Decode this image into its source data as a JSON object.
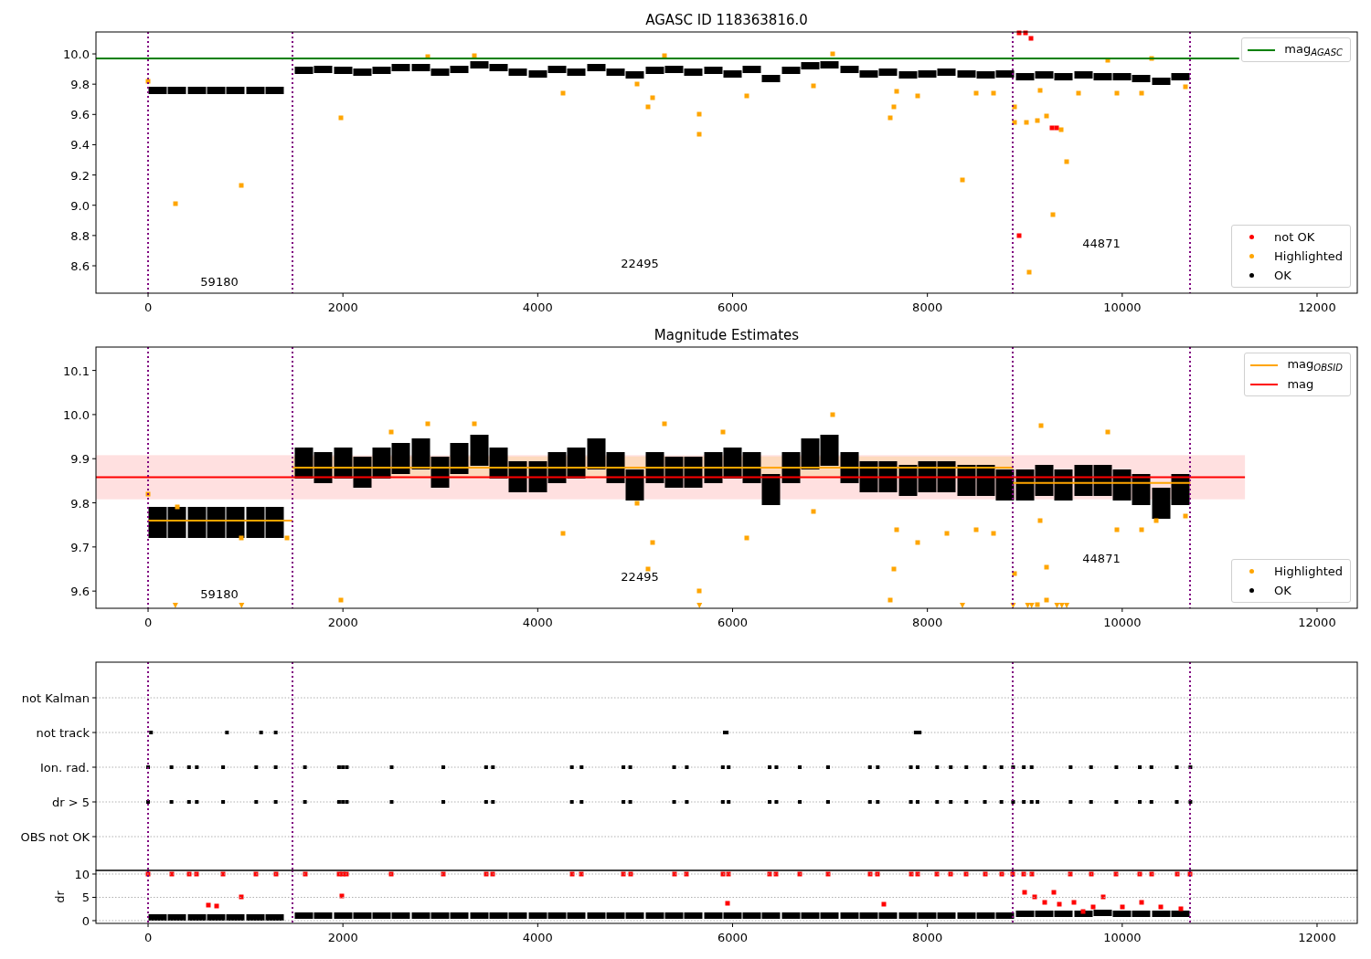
{
  "figure": {
    "panels": [
      {
        "chart_data": {
          "type": "scatter",
          "title": "AGASC ID 118363816.0",
          "xlim": [
            -535,
            12413
          ],
          "ylim": [
            8.419,
            10.145
          ],
          "xticks": [
            0,
            2000,
            4000,
            6000,
            8000,
            10000,
            12000
          ],
          "yticks": [
            {
              "value": 8.6,
              "label": "8.6"
            },
            {
              "value": 8.8,
              "label": "8.8"
            },
            {
              "value": 9.0,
              "label": "9.0"
            },
            {
              "value": 9.2,
              "label": "9.2"
            },
            {
              "value": 9.4,
              "label": "9.4"
            },
            {
              "value": 9.6,
              "label": "9.6"
            },
            {
              "value": 9.8,
              "label": "9.8"
            },
            {
              "value": 10.0,
              "label": "10.0"
            }
          ],
          "series": [
            {
              "name": "mag$_{AGASC}$",
              "color": "#008000",
              "type": "line",
              "x": [
                -535,
                11200
              ],
              "values": [
                9.97,
                9.97
              ]
            },
            {
              "name": "OK",
              "color": "#000000",
              "type": "scatter",
              "x": [
                100,
                300,
                500,
                700,
                900,
                1100,
                1300,
                1600,
                1800,
                2000,
                2200,
                2400,
                2600,
                2800,
                3000,
                3200,
                3400,
                3600,
                3800,
                4000,
                4200,
                4400,
                4600,
                4800,
                5000,
                5200,
                5400,
                5600,
                5800,
                6000,
                6200,
                6400,
                6600,
                6800,
                7000,
                7200,
                7400,
                7600,
                7800,
                8000,
                8200,
                8400,
                8600,
                8800,
                9000,
                9200,
                9400,
                9600,
                9800,
                10000,
                10200,
                10400,
                10600
              ],
              "values": [
                9.76,
                9.76,
                9.76,
                9.76,
                9.76,
                9.76,
                9.76,
                9.89,
                9.9,
                9.89,
                9.88,
                9.89,
                9.91,
                9.91,
                9.88,
                9.9,
                9.93,
                9.91,
                9.88,
                9.87,
                9.9,
                9.88,
                9.91,
                9.88,
                9.86,
                9.89,
                9.9,
                9.88,
                9.89,
                9.87,
                9.9,
                9.84,
                9.89,
                9.92,
                9.93,
                9.9,
                9.87,
                9.88,
                9.86,
                9.87,
                9.88,
                9.87,
                9.86,
                9.87,
                9.85,
                9.86,
                9.85,
                9.86,
                9.85,
                9.85,
                9.84,
                9.82,
                9.85
              ]
            },
            {
              "name": "Highlighted",
              "color": "#ffa500",
              "type": "scatter",
              "x": [
                0,
                280,
                960,
                1980,
                2870,
                3350,
                4260,
                5020,
                5130,
                5180,
                5300,
                5660,
                5660,
                6150,
                6830,
                7030,
                7620,
                7660,
                7680,
                7900,
                8360,
                8500,
                8680,
                8890,
                8890,
                9020,
                9040,
                9130,
                9160,
                9220,
                9290,
                9370,
                9430,
                9550,
                9850,
                9950,
                10200,
                10300,
                10650
              ],
              "values": [
                9.82,
                9.01,
                9.13,
                9.58,
                9.98,
                9.99,
                9.74,
                9.8,
                9.65,
                9.71,
                9.99,
                9.6,
                9.47,
                9.72,
                9.79,
                10.0,
                9.58,
                9.65,
                9.75,
                9.72,
                9.17,
                9.74,
                9.74,
                9.65,
                9.55,
                9.55,
                8.56,
                9.56,
                9.76,
                9.59,
                8.94,
                9.5,
                9.29,
                9.74,
                9.96,
                9.74,
                9.74,
                9.97,
                9.78
              ]
            },
            {
              "name": "not OK",
              "color": "#ff0000",
              "type": "scatter",
              "x": [
                8945,
                9005,
                9060,
                8940,
                9280,
                9330
              ],
              "values": [
                10.14,
                10.14,
                10.1,
                8.8,
                9.51,
                9.51
              ]
            }
          ],
          "ref_lines": [
            {
              "axis": "x",
              "value": 0,
              "color": "#800080"
            },
            {
              "axis": "x",
              "value": 1480,
              "color": "#800080"
            },
            {
              "axis": "x",
              "value": 8880,
              "color": "#800080"
            },
            {
              "axis": "x",
              "value": 10700,
              "color": "#800080"
            }
          ],
          "annotations": [
            "59180",
            "22495",
            "44871"
          ]
        }
      },
      {
        "chart_data": {
          "type": "scatter",
          "title": "Magnitude Estimates",
          "xlim": [
            -535,
            12413
          ],
          "ylim": [
            9.561,
            10.153
          ],
          "xticks": [
            0,
            2000,
            4000,
            6000,
            8000,
            10000,
            12000
          ],
          "yticks": [
            {
              "value": 9.6,
              "label": "9.6"
            },
            {
              "value": 9.7,
              "label": "9.7"
            },
            {
              "value": 9.8,
              "label": "9.8"
            },
            {
              "value": 9.9,
              "label": "9.9"
            },
            {
              "value": 10.0,
              "label": "10.0"
            },
            {
              "value": 10.1,
              "label": "10.1"
            }
          ],
          "series": [
            {
              "name": "mag$_{OBSID}$",
              "color": "#ffa500",
              "type": "line",
              "x": [
                0,
                1480,
                null,
                1480,
                8880,
                null,
                8880,
                10700
              ],
              "values": [
                9.76,
                9.76,
                null,
                9.88,
                9.88,
                null,
                9.845,
                9.845
              ]
            },
            {
              "name": "mag",
              "color": "#ff0000",
              "type": "line",
              "x": [
                -535,
                11260
              ],
              "values": [
                9.858,
                9.858
              ]
            },
            {
              "name": "OK",
              "color": "#000000",
              "type": "scatter",
              "x": [
                100,
                300,
                500,
                700,
                900,
                1100,
                1300,
                1600,
                1800,
                2000,
                2200,
                2400,
                2600,
                2800,
                3000,
                3200,
                3400,
                3600,
                3800,
                4000,
                4200,
                4400,
                4600,
                4800,
                5000,
                5200,
                5400,
                5600,
                5800,
                6000,
                6200,
                6400,
                6600,
                6800,
                7000,
                7200,
                7400,
                7600,
                7800,
                8000,
                8200,
                8400,
                8600,
                8800,
                9000,
                9200,
                9400,
                9600,
                9800,
                10000,
                10200,
                10400,
                10600
              ],
              "values": [
                9.755,
                9.755,
                9.755,
                9.755,
                9.755,
                9.755,
                9.755,
                9.89,
                9.88,
                9.89,
                9.87,
                9.89,
                9.9,
                9.91,
                9.87,
                9.9,
                9.92,
                9.89,
                9.86,
                9.86,
                9.88,
                9.89,
                9.91,
                9.88,
                9.84,
                9.88,
                9.87,
                9.87,
                9.88,
                9.89,
                9.88,
                9.83,
                9.88,
                9.91,
                9.92,
                9.88,
                9.86,
                9.86,
                9.85,
                9.86,
                9.86,
                9.85,
                9.85,
                9.84,
                9.84,
                9.85,
                9.84,
                9.85,
                9.85,
                9.84,
                9.83,
                9.8,
                9.83
              ]
            },
            {
              "name": "Highlighted",
              "color": "#ffa500",
              "type": "scatter",
              "x": [
                0,
                300,
                960,
                1430,
                1980,
                2500,
                2870,
                3350,
                4260,
                5020,
                5130,
                5180,
                5300,
                5660,
                5900,
                6150,
                6830,
                7030,
                7620,
                7660,
                7680,
                7900,
                8200,
                8500,
                8680,
                8890,
                9130,
                9160,
                9170,
                9220,
                9220,
                9850,
                9950,
                10200,
                10350,
                10650,
                280,
                960,
                5660,
                8360,
                8880,
                9030,
                9070,
                9330,
                9380,
                9430
              ],
              "values": [
                9.82,
                9.79,
                9.72,
                9.72,
                9.58,
                9.96,
                9.98,
                9.98,
                9.73,
                9.8,
                9.65,
                9.71,
                9.98,
                9.6,
                9.96,
                9.72,
                9.78,
                10.0,
                9.58,
                9.65,
                9.74,
                9.71,
                9.73,
                9.74,
                9.73,
                9.64,
                9.57,
                9.76,
                9.975,
                9.58,
                9.655,
                9.96,
                9.74,
                9.74,
                9.76,
                9.77,
                9.567,
                9.567,
                9.567,
                9.567,
                9.567,
                9.567,
                9.567,
                9.567,
                9.567,
                9.567
              ]
            }
          ],
          "bands": [
            {
              "axis": "y",
              "from": 9.808,
              "to": 9.908,
              "color": "#ffe0e0"
            },
            {
              "axis": "y",
              "from": 9.855,
              "to": 9.905,
              "color": "#fdd9bd"
            }
          ],
          "ref_lines": [
            {
              "axis": "x",
              "value": 0,
              "color": "#800080"
            },
            {
              "axis": "x",
              "value": 1480,
              "color": "#800080"
            },
            {
              "axis": "x",
              "value": 8880,
              "color": "#800080"
            },
            {
              "axis": "x",
              "value": 10700,
              "color": "#800080"
            }
          ],
          "annotations": [
            "59180",
            "22495",
            "44871"
          ]
        }
      },
      {
        "flag_rows": [
          "not Kalman",
          "not track",
          "Ion. rad.",
          "dr > 5",
          "OBS not OK"
        ]
      },
      {
        "chart_data": {
          "type": "scatter",
          "ylabel": "dr",
          "grid": true,
          "xlim": [
            -535,
            12413
          ],
          "ylim": [
            -0.59,
            10.78
          ],
          "xticks": [
            0,
            2000,
            4000,
            6000,
            8000,
            10000,
            12000
          ],
          "yticks": [
            {
              "value": 0,
              "label": "0"
            },
            {
              "value": 5,
              "label": "5"
            },
            {
              "value": 10,
              "label": "10"
            }
          ],
          "series": [
            {
              "color": "#000000",
              "type": "scatter",
              "x": [
                100,
                300,
                500,
                700,
                900,
                1100,
                1300,
                1600,
                1800,
                2000,
                2200,
                2400,
                2600,
                2800,
                3000,
                3200,
                3400,
                3600,
                3800,
                4000,
                4200,
                4400,
                4600,
                4800,
                5000,
                5200,
                5400,
                5600,
                5800,
                6000,
                6200,
                6400,
                6600,
                6800,
                7000,
                7200,
                7400,
                7600,
                7800,
                8000,
                8200,
                8400,
                8600,
                8800,
                9000,
                9200,
                9400,
                9600,
                9800,
                10000,
                10200,
                10400,
                10600
              ],
              "values": [
                0.6,
                0.6,
                0.6,
                0.6,
                0.6,
                0.6,
                0.6,
                1.0,
                1.0,
                1.1,
                1.0,
                1.0,
                1.0,
                1.0,
                1.0,
                1.0,
                1.0,
                1.0,
                1.0,
                1.0,
                1.0,
                1.0,
                1.1,
                1.0,
                1.0,
                1.0,
                1.0,
                1.0,
                1.0,
                1.0,
                1.1,
                1.0,
                1.0,
                1.0,
                1.0,
                1.0,
                1.0,
                1.0,
                1.0,
                1.1,
                1.0,
                1.0,
                1.0,
                1.0,
                1.5,
                1.5,
                1.5,
                1.5,
                1.6,
                1.5,
                1.5,
                1.5,
                1.5
              ]
            },
            {
              "color": "#ff0000",
              "type": "scatter",
              "x": [
                0,
                240,
                420,
                500,
                770,
                1110,
                1310,
                1610,
                1960,
                2000,
                2040,
                2500,
                3030,
                3470,
                3540,
                4350,
                4450,
                4880,
                4950,
                5400,
                5530,
                5900,
                5960,
                6380,
                6450,
                6690,
                6980,
                7410,
                7490,
                7830,
                7900,
                8100,
                8240,
                8400,
                8590,
                8760,
                8880,
                8990,
                9070,
                9470,
                9680,
                9940,
                10180,
                10300,
                10560,
                10700,
                620,
                700,
                960,
                1990,
                5950,
                7550,
                9000,
                9100,
                9200,
                9300,
                9350,
                9500,
                9600,
                9700,
                9800,
                10000,
                10200,
                10400,
                10600
              ],
              "values": [
                10,
                10,
                10,
                10,
                10,
                10,
                10,
                10,
                10,
                10,
                10,
                10,
                10,
                10,
                10,
                10,
                10,
                10,
                10,
                10,
                10,
                10,
                10,
                10,
                10,
                10,
                10,
                10,
                10,
                10,
                10,
                10,
                10,
                10,
                10,
                10,
                10,
                10,
                10,
                10,
                10,
                10,
                10,
                10,
                10,
                10,
                3.3,
                3.2,
                5.0,
                5.2,
                3.8,
                3.5,
                6.0,
                5.0,
                4.0,
                6.0,
                3.5,
                4.0,
                2.0,
                3.0,
                5.0,
                3.0,
                4.0,
                3.0,
                2.5
              ]
            }
          ],
          "ref_lines": [
            {
              "axis": "x",
              "value": 0,
              "color": "#800080"
            },
            {
              "axis": "x",
              "value": 1480,
              "color": "#800080"
            },
            {
              "axis": "x",
              "value": 8880,
              "color": "#800080"
            },
            {
              "axis": "x",
              "value": 10700,
              "color": "#800080"
            }
          ]
        }
      }
    ]
  }
}
